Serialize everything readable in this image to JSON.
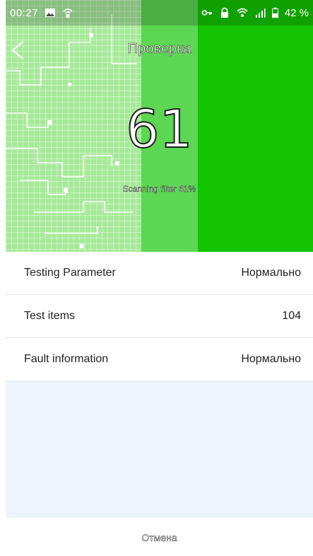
{
  "status_bar": {
    "time": "00:27",
    "battery": "42 %",
    "icons": [
      "image-icon",
      "wifi-lock-icon",
      "key-icon",
      "lock-icon",
      "wifi-icon",
      "signal-icon",
      "battery-icon"
    ]
  },
  "header": {
    "title": "Проверка",
    "back_icon": "chevron-left-icon"
  },
  "scan": {
    "progress_number": "61",
    "progress_percent": 61,
    "status_text": "Scanning filter 61%"
  },
  "results": [
    {
      "label": "Testing Parameter",
      "value": "Нормально"
    },
    {
      "label": "Test items",
      "value": "104"
    },
    {
      "label": "Fault information",
      "value": "Нормально"
    }
  ],
  "footer": {
    "cancel_label": "Отмена"
  },
  "colors": {
    "accent_green": "#14c400",
    "mid_green": "#5cd653",
    "light_green": "#a7e99a",
    "panel_blue": "#edf4fd"
  }
}
